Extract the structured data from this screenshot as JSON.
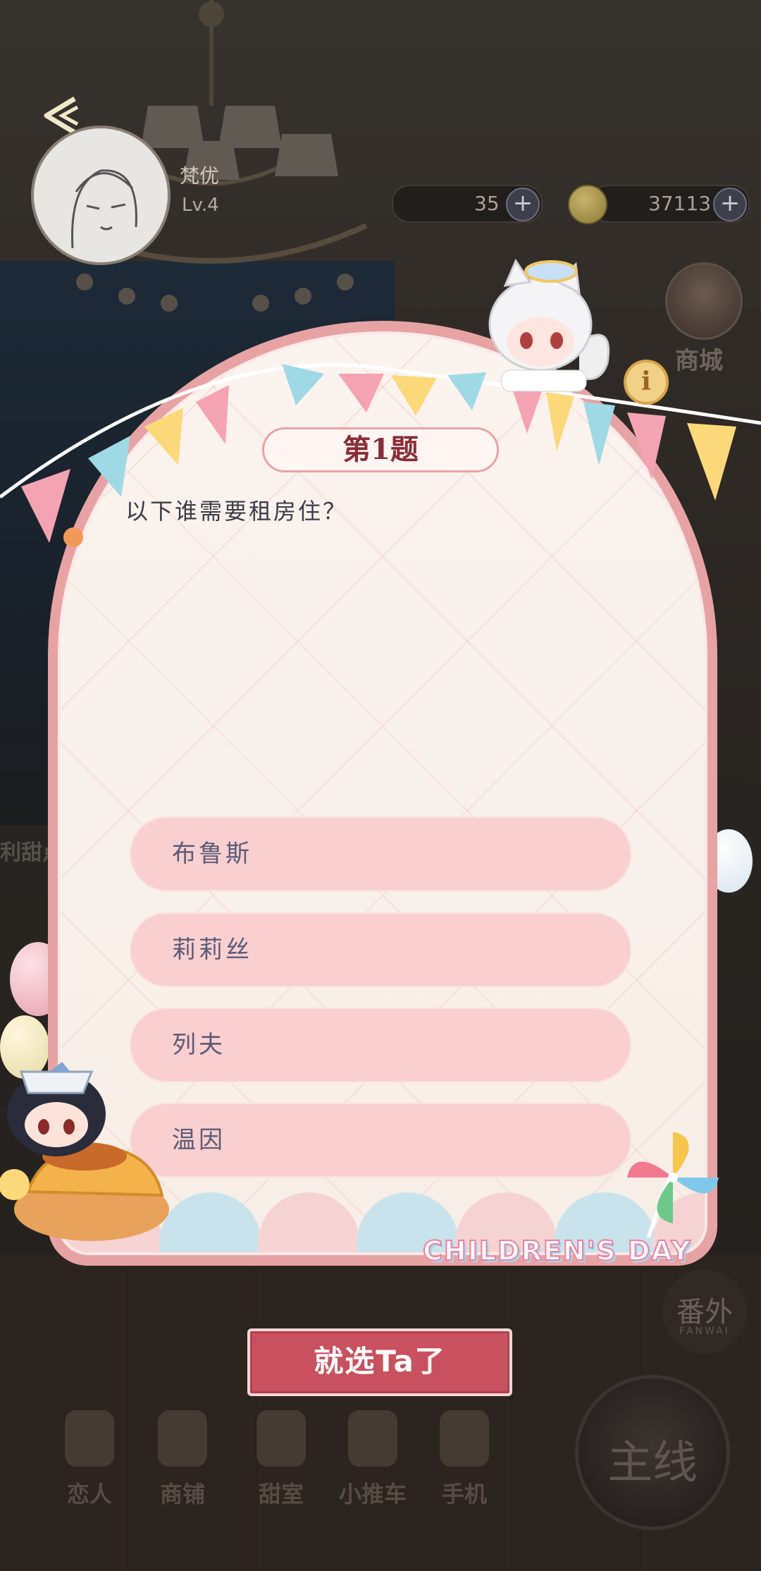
{
  "hud": {
    "player_name": "梵优",
    "player_level": "Lv.4",
    "stamina": "35",
    "coins": "37113",
    "plus": "+",
    "shop_label": "商城",
    "info": "i",
    "side_partial": "利甜点"
  },
  "quiz": {
    "number_label": "第1题",
    "question": "以下谁需要租房住？",
    "options": [
      {
        "label": "布鲁斯"
      },
      {
        "label": "莉莉丝"
      },
      {
        "label": "列夫"
      },
      {
        "label": "温因"
      }
    ],
    "event_text": "CHILDREN'S DAY"
  },
  "confirm_label": "就选Ta了",
  "nav": {
    "items": [
      {
        "label": "恋人"
      },
      {
        "label": "商铺"
      },
      {
        "label": "甜室"
      },
      {
        "label": "小推车"
      },
      {
        "label": "手机"
      }
    ],
    "main_label": "主线",
    "fanwai_label": "番外",
    "fanwai_sub": "FANWAI"
  },
  "colors": {
    "card_border": "#e7a3a3",
    "option_bg": "#f9cfcf",
    "confirm_bg": "#c9505e",
    "question_title": "#8a2c38"
  },
  "icons": [
    "back-arrow-icon",
    "plus-icon",
    "coin-icon",
    "info-icon",
    "pinwheel-icon",
    "bunting-flags"
  ]
}
